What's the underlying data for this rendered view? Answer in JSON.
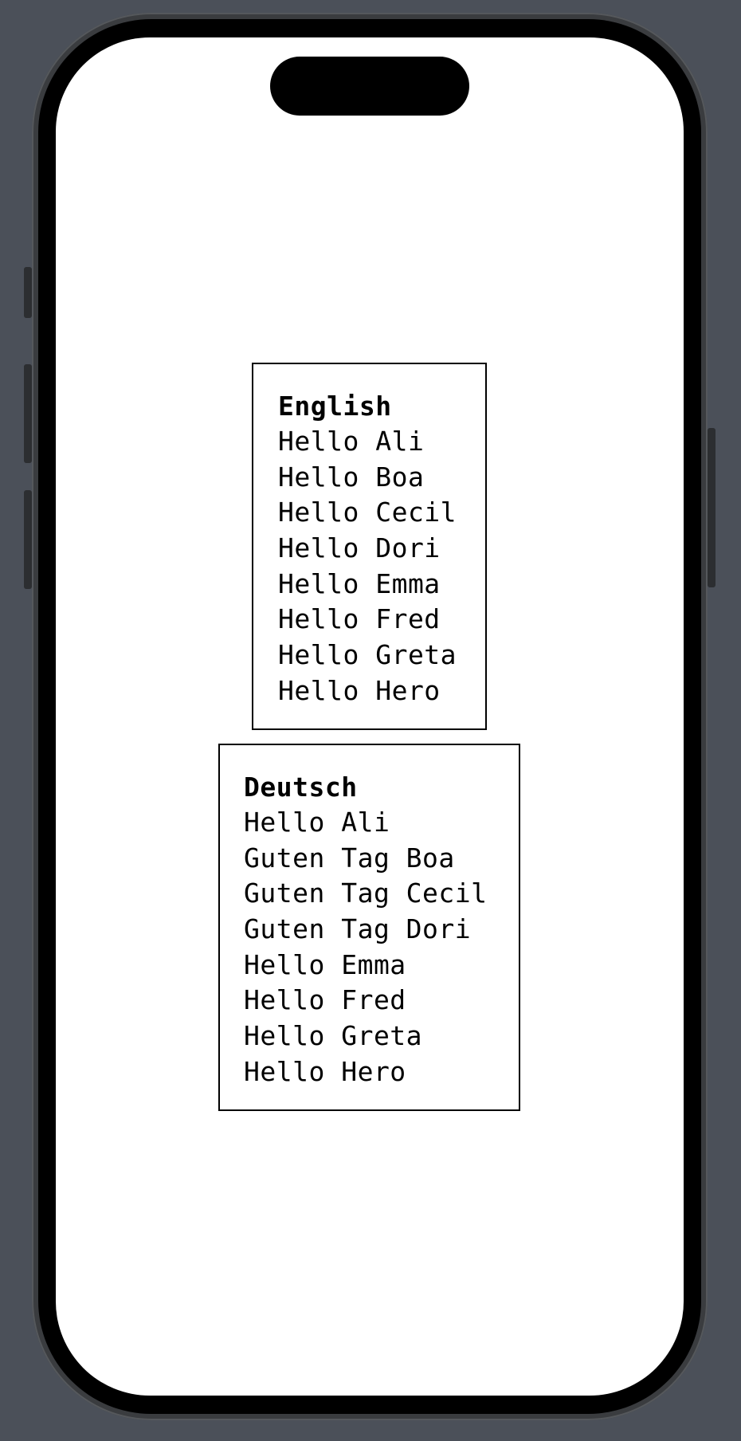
{
  "english": {
    "title": "English",
    "greetings": [
      "Hello Ali",
      "Hello Boa",
      "Hello Cecil",
      "Hello Dori",
      "Hello Emma",
      "Hello Fred",
      "Hello Greta",
      "Hello Hero"
    ]
  },
  "deutsch": {
    "title": "Deutsch",
    "greetings": [
      "Hello Ali",
      "Guten Tag Boa",
      "Guten Tag Cecil",
      "Guten Tag Dori",
      "Hello Emma",
      "Hello Fred",
      "Hello Greta",
      "Hello Hero"
    ]
  }
}
